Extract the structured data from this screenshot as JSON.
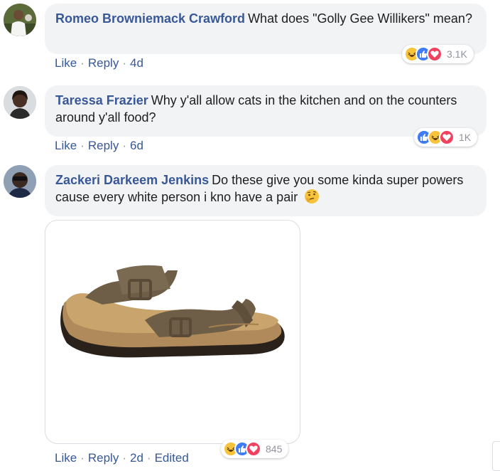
{
  "comments": [
    {
      "author": "Romeo Browniemack Crawford",
      "text": "What does \"Golly Gee Willikers\" mean?",
      "actions": {
        "like": "Like",
        "reply": "Reply",
        "time": "4d"
      },
      "reactions": {
        "icons": [
          "haha-icon",
          "like-icon",
          "love-icon"
        ],
        "count": "3.1K"
      }
    },
    {
      "author": "Taressa Frazier",
      "text": "Why y'all allow cats in the kitchen and on the counters around y'all food?",
      "actions": {
        "like": "Like",
        "reply": "Reply",
        "time": "6d"
      },
      "reactions": {
        "icons": [
          "like-icon",
          "haha-icon",
          "love-icon"
        ],
        "count": "1K"
      }
    },
    {
      "author": "Zackeri Darkeem Jenkins",
      "text": "Do these give you some kinda super powers cause every white person i kno have a pair",
      "emoji": "thinking-face-icon",
      "attachment": "sandal-photo",
      "actions": {
        "like": "Like",
        "reply": "Reply",
        "time": "2d",
        "edited": "Edited"
      },
      "reactions": {
        "icons": [
          "haha-icon",
          "like-icon",
          "love-icon"
        ],
        "count": "845"
      }
    }
  ],
  "colors": {
    "author": "#385898",
    "bubble": "#f2f3f5",
    "muted": "#90949c",
    "like": "#3e7bf5",
    "love": "#f0425e",
    "haha": "#f7c33b"
  }
}
